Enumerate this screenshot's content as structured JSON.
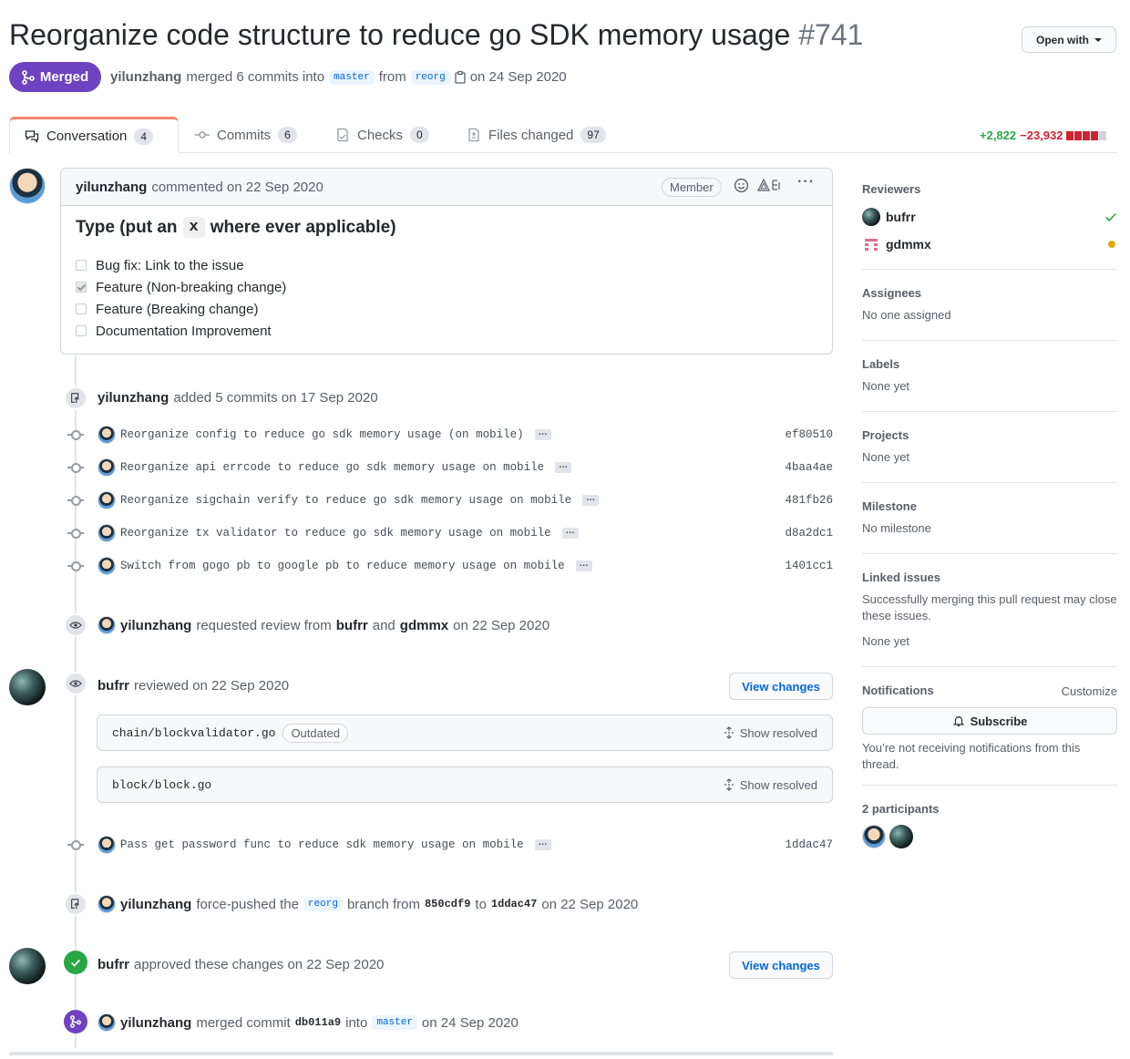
{
  "header": {
    "title": "Reorganize code structure to reduce go SDK memory usage",
    "number": "#741",
    "open_with": "Open with",
    "state": "Merged",
    "author": "yilunzhang",
    "merged_text": "merged 6 commits into",
    "base_branch": "master",
    "from_text": "from",
    "head_branch": "reorg",
    "date_text": "on 24 Sep 2020"
  },
  "tabs": [
    {
      "label": "Conversation",
      "count": "4"
    },
    {
      "label": "Commits",
      "count": "6"
    },
    {
      "label": "Checks",
      "count": "0"
    },
    {
      "label": "Files changed",
      "count": "97"
    }
  ],
  "diffstat": {
    "additions": "+2,822",
    "deletions": "−23,932",
    "colors": [
      "#cb2431",
      "#cb2431",
      "#cb2431",
      "#cb2431",
      "#d1d5da"
    ]
  },
  "comment": {
    "author": "yilunzhang",
    "action": "commented on 22 Sep 2020",
    "role": "Member",
    "heading_pre": "Type (put an",
    "heading_code": "x",
    "heading_post": "where ever applicable)",
    "tasks": [
      {
        "label": "Bug fix: Link to the issue",
        "checked": false
      },
      {
        "label": "Feature (Non-breaking change)",
        "checked": true
      },
      {
        "label": "Feature (Breaking change)",
        "checked": false
      },
      {
        "label": "Documentation Improvement",
        "checked": false
      }
    ]
  },
  "commits_event": {
    "author": "yilunzhang",
    "text": "added 5 commits on 17 Sep 2020"
  },
  "commits": [
    {
      "msg": "Reorganize config to reduce go sdk memory usage (on mobile)",
      "sha": "ef80510"
    },
    {
      "msg": "Reorganize api errcode to reduce go sdk memory usage on mobile",
      "sha": "4baa4ae"
    },
    {
      "msg": "Reorganize sigchain verify to reduce go sdk memory usage on mobile",
      "sha": "481fb26"
    },
    {
      "msg": "Reorganize tx validator to reduce go sdk memory usage on mobile",
      "sha": "d8a2dc1"
    },
    {
      "msg": "Switch from gogo pb to google pb to reduce memory usage on mobile",
      "sha": "1401cc1"
    }
  ],
  "review_request": {
    "author": "yilunzhang",
    "text1": "requested review from",
    "r1": "bufrr",
    "and": "and",
    "r2": "gdmmx",
    "date": "on 22 Sep 2020"
  },
  "review": {
    "author": "bufrr",
    "text": "reviewed on 22 Sep 2020",
    "button": "View changes",
    "files": [
      {
        "name": "chain/blockvalidator.go",
        "badge": "Outdated",
        "action": "Show resolved"
      },
      {
        "name": "block/block.go",
        "action": "Show resolved"
      }
    ]
  },
  "later_commit": {
    "msg": "Pass get password func to reduce sdk memory usage on mobile",
    "sha": "1ddac47"
  },
  "force_push": {
    "author": "yilunzhang",
    "text1": "force-pushed the",
    "branch": "reorg",
    "text2": "branch from",
    "from_sha": "850cdf9",
    "to": "to",
    "to_sha": "1ddac47",
    "date": "on 22 Sep 2020"
  },
  "approval": {
    "author": "bufrr",
    "text": "approved these changes on 22 Sep 2020",
    "button": "View changes"
  },
  "merge_event": {
    "author": "yilunzhang",
    "text1": "merged commit",
    "sha": "db011a9",
    "into": "into",
    "branch": "master",
    "date": "on 24 Sep 2020"
  },
  "sidebar": {
    "reviewers_title": "Reviewers",
    "reviewers": [
      {
        "name": "bufrr",
        "status": "approved"
      },
      {
        "name": "gdmmx",
        "status": "pending"
      }
    ],
    "assignees_title": "Assignees",
    "assignees_text": "No one assigned",
    "labels_title": "Labels",
    "labels_text": "None yet",
    "projects_title": "Projects",
    "projects_text": "None yet",
    "milestone_title": "Milestone",
    "milestone_text": "No milestone",
    "linked_title": "Linked issues",
    "linked_desc": "Successfully merging this pull request may close these issues.",
    "linked_text": "None yet",
    "notifications_title": "Notifications",
    "customize": "Customize",
    "subscribe": "Subscribe",
    "notif_desc": "You’re not receiving notifications from this thread.",
    "participants_title": "2 participants"
  }
}
